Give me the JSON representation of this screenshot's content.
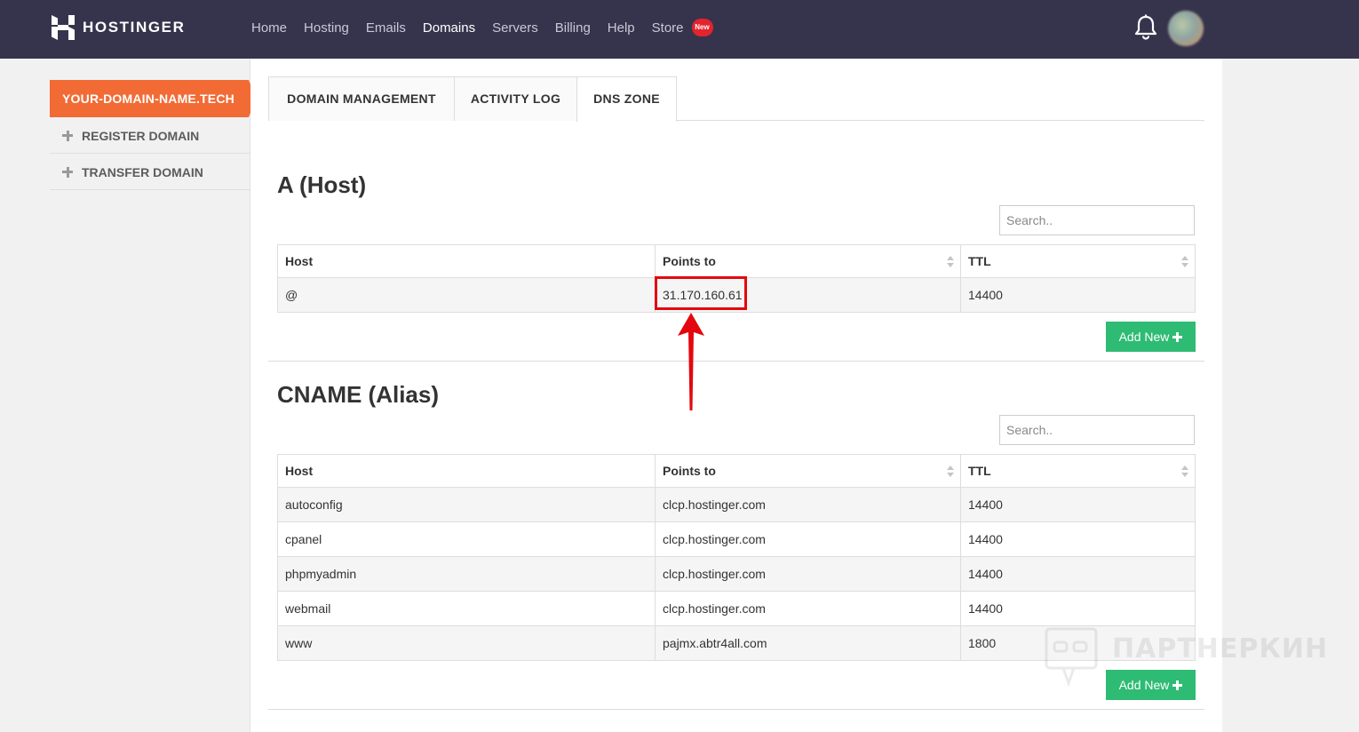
{
  "app": {
    "brand": "HOSTINGER",
    "colors": {
      "topbar": "#36344d",
      "accent": "#f26b35",
      "add_button": "#2ebb73",
      "badge": "#e3232d",
      "annotation": "#e3080f"
    }
  },
  "nav": {
    "items": [
      "Home",
      "Hosting",
      "Emails",
      "Domains",
      "Servers",
      "Billing",
      "Help",
      "Store"
    ],
    "active": "Domains",
    "store_badge": "New",
    "notification_icon": "bell-icon",
    "avatar_icon": "user-avatar"
  },
  "sidebar": {
    "domain": "YOUR-DOMAIN-NAME.TECH",
    "items": [
      {
        "label": "REGISTER DOMAIN",
        "icon": "plus-icon"
      },
      {
        "label": "TRANSFER DOMAIN",
        "icon": "plus-icon"
      }
    ]
  },
  "tabs": {
    "items": [
      "DOMAIN MANAGEMENT",
      "ACTIVITY LOG",
      "DNS ZONE"
    ],
    "active": "DNS ZONE"
  },
  "a_records": {
    "title": "A (Host)",
    "search_placeholder": "Search..",
    "columns": [
      "Host",
      "Points to",
      "TTL"
    ],
    "rows": [
      [
        "@",
        "31.170.160.61",
        "14400"
      ]
    ],
    "add_label": "Add New"
  },
  "cname_records": {
    "title": "CNAME (Alias)",
    "search_placeholder": "Search..",
    "columns": [
      "Host",
      "Points to",
      "TTL"
    ],
    "rows": [
      [
        "autoconfig",
        "clcp.hostinger.com",
        "14400"
      ],
      [
        "cpanel",
        "clcp.hostinger.com",
        "14400"
      ],
      [
        "phpmyadmin",
        "clcp.hostinger.com",
        "14400"
      ],
      [
        "webmail",
        "clcp.hostinger.com",
        "14400"
      ],
      [
        "www",
        "pajmx.abtr4all.com",
        "1800"
      ]
    ],
    "add_label": "Add New"
  },
  "watermark": {
    "text": "ПАРТНЕРКИН"
  }
}
